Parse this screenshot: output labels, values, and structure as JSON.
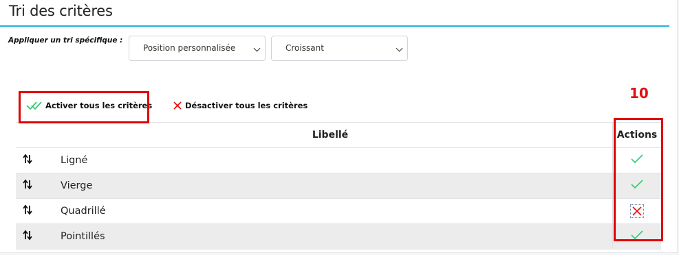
{
  "panel": {
    "title": "Tri des critères",
    "sort_label": "Appliquer un tri spécifique :",
    "sort_field_value": "Position personnalisée",
    "sort_order_value": "Croissant"
  },
  "bulk_actions": {
    "activate_label": "Activer tous les critères",
    "deactivate_label": "Désactiver tous les critères"
  },
  "annotation_count": "10",
  "table": {
    "headers": [
      "",
      "Libellé",
      "Actions"
    ],
    "rows": [
      {
        "label": "Ligné",
        "active": true
      },
      {
        "label": "Vierge",
        "active": true
      },
      {
        "label": "Quadrillé",
        "active": false
      },
      {
        "label": "Pointillés",
        "active": true
      }
    ]
  },
  "colors": {
    "accent": "#1eb3df",
    "check": "#2ecc71",
    "cross": "#e01010",
    "highlight": "#e00000"
  },
  "icons": {
    "handle": "sort-handle-icon",
    "active": "check-icon",
    "inactive": "close-icon"
  }
}
